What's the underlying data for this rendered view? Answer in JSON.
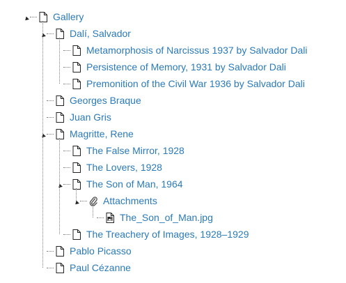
{
  "tree": [
    {
      "label": "Gallery",
      "level": 0,
      "expanded": true,
      "icon": "document-icon",
      "name": "gallery"
    },
    {
      "label": "Dalí, Salvador",
      "level": 1,
      "expanded": true,
      "icon": "document-icon",
      "name": "dali-salvador"
    },
    {
      "label": "Metamorphosis of Narcissus 1937 by Salvador Dali",
      "level": 2,
      "icon": "document-icon",
      "name": "metamorphosis-of-narcissus"
    },
    {
      "label": "Persistence of Memory, 1931 by Salvador Dali",
      "level": 2,
      "icon": "document-icon",
      "name": "persistence-of-memory"
    },
    {
      "label": "Premonition of the Civil War 1936 by Salvador Dali",
      "level": 2,
      "icon": "document-icon",
      "name": "premonition-of-the-civil-war"
    },
    {
      "label": "Georges Braque",
      "level": 1,
      "icon": "document-icon",
      "name": "georges-braque"
    },
    {
      "label": "Juan Gris",
      "level": 1,
      "icon": "document-icon",
      "name": "juan-gris"
    },
    {
      "label": "Magritte, Rene",
      "level": 1,
      "expanded": true,
      "icon": "document-icon",
      "name": "magritte-rene"
    },
    {
      "label": "The False Mirror, 1928",
      "level": 2,
      "icon": "document-icon",
      "name": "the-false-mirror"
    },
    {
      "label": "The Lovers, 1928",
      "level": 2,
      "icon": "document-icon",
      "name": "the-lovers"
    },
    {
      "label": "The Son of Man, 1964",
      "level": 2,
      "expanded": true,
      "icon": "document-icon",
      "name": "the-son-of-man"
    },
    {
      "label": "Attachments",
      "level": 3,
      "expanded": true,
      "icon": "paperclip-icon",
      "name": "attachments"
    },
    {
      "label": "The_Son_of_Man.jpg",
      "level": 4,
      "icon": "image-file-icon",
      "name": "the-son-of-man-jpg"
    },
    {
      "label": "The Treachery of Images, 1928–1929",
      "level": 2,
      "icon": "document-icon",
      "name": "the-treachery-of-images"
    },
    {
      "label": "Pablo Picasso",
      "level": 1,
      "icon": "document-icon",
      "name": "pablo-picasso"
    },
    {
      "label": "Paul Cézanne",
      "level": 1,
      "icon": "document-icon",
      "name": "paul-cezanne"
    }
  ],
  "colors": {
    "link": "#2a7ab8",
    "connector": "#7a7a7a",
    "toggle": "#222222"
  }
}
